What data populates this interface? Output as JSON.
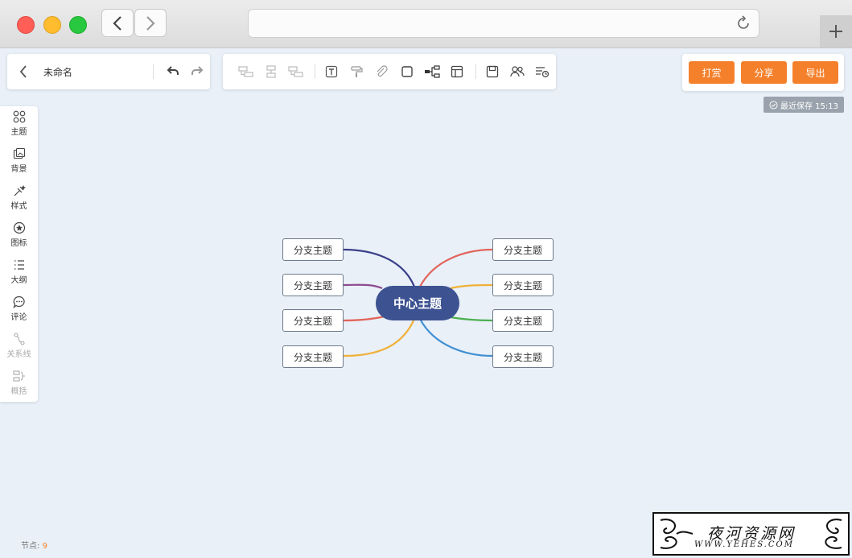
{
  "document": {
    "title": "未命名"
  },
  "actions": {
    "reward": "打赏",
    "share": "分享",
    "export": "导出"
  },
  "status": {
    "saved": "最近保存 15:13"
  },
  "sidebar": {
    "items": [
      {
        "label": "主题",
        "icon": "theme-icon",
        "enabled": true
      },
      {
        "label": "背景",
        "icon": "background-image-icon",
        "enabled": true
      },
      {
        "label": "样式",
        "icon": "style-brush-icon",
        "enabled": true
      },
      {
        "label": "图标",
        "icon": "star-icon",
        "enabled": true
      },
      {
        "label": "大纲",
        "icon": "outline-list-icon",
        "enabled": true
      },
      {
        "label": "评论",
        "icon": "comment-icon",
        "enabled": true
      },
      {
        "label": "关系线",
        "icon": "relation-line-icon",
        "enabled": false
      },
      {
        "label": "概括",
        "icon": "summary-icon",
        "enabled": false
      }
    ]
  },
  "toolbar": {
    "icons": [
      "add-sibling-icon",
      "add-child-icon",
      "add-parent-icon",
      "text-icon",
      "format-paint-icon",
      "attachment-icon",
      "border-icon",
      "structure-icon",
      "layout-icon",
      "save-icon",
      "collaborate-icon",
      "note-icon"
    ]
  },
  "mindmap": {
    "center": "中心主题",
    "center_color": "#3d5291",
    "branches_left": [
      "分支主题",
      "分支主题",
      "分支主题",
      "分支主题"
    ],
    "branches_right": [
      "分支主题",
      "分支主题",
      "分支主题",
      "分支主题"
    ],
    "colors_left": [
      "#3b3f8a",
      "#8e4a8e",
      "#e2645a",
      "#f0b13a"
    ],
    "colors_right": [
      "#e2645a",
      "#f0b13a",
      "#4caf50",
      "#3f8fd2"
    ]
  },
  "footer": {
    "label": "节点:",
    "count": "9"
  },
  "watermark": {
    "name": "夜河资源网",
    "url": "WWW.YEHES.COM"
  },
  "colors": {
    "accent": "#f5802b",
    "canvas": "#e9f0f8"
  }
}
